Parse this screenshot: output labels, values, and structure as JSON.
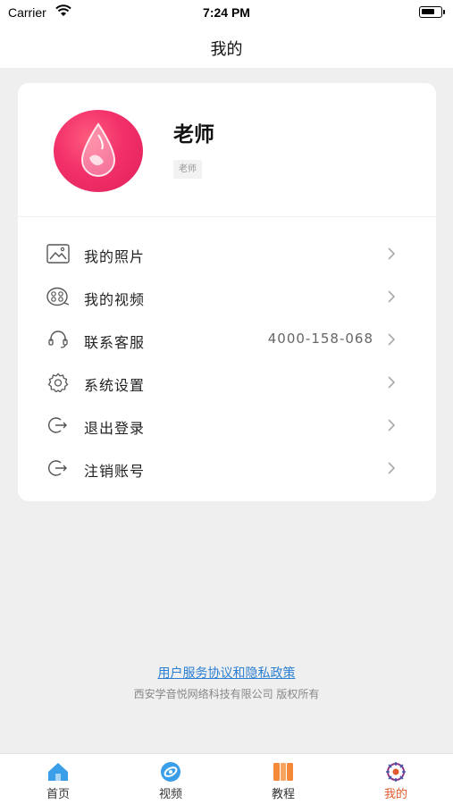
{
  "status_bar": {
    "carrier": "Carrier",
    "time": "7:24 PM"
  },
  "header": {
    "title": "我的"
  },
  "profile": {
    "name": "老师",
    "role": "老师"
  },
  "menu": [
    {
      "label": "我的照片",
      "value": "",
      "icon": "photo-icon"
    },
    {
      "label": "我的视频",
      "value": "",
      "icon": "video-reel-icon"
    },
    {
      "label": "联系客服",
      "value": "4000-158-068",
      "icon": "headset-icon"
    },
    {
      "label": "系统设置",
      "value": "",
      "icon": "gear-icon"
    },
    {
      "label": "退出登录",
      "value": "",
      "icon": "logout-icon"
    },
    {
      "label": "注销账号",
      "value": "",
      "icon": "logout-icon"
    }
  ],
  "footer": {
    "policy_link": "用户服务协议和隐私政策",
    "copyright": "西安学音悦网络科技有限公司 版权所有"
  },
  "tabs": [
    {
      "label": "首页",
      "icon": "home-icon",
      "active": false
    },
    {
      "label": "视频",
      "icon": "video-icon",
      "active": false
    },
    {
      "label": "教程",
      "icon": "book-icon",
      "active": false
    },
    {
      "label": "我的",
      "icon": "profile-icon",
      "active": true
    }
  ],
  "colors": {
    "accent": "#e05a2b",
    "link": "#2a7fd4",
    "avatar": "#f2306a",
    "tab_blue": "#3a9fe8",
    "tab_orange": "#f5893a"
  }
}
